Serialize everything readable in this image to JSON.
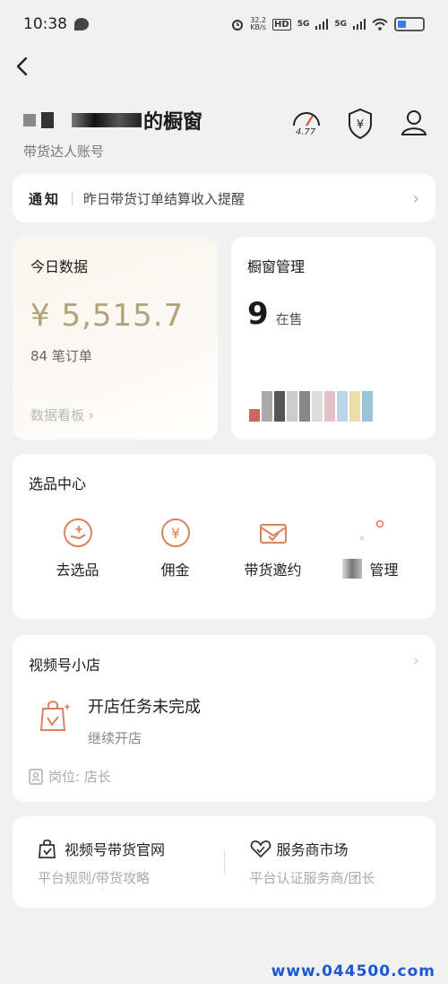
{
  "status_bar": {
    "time": "10:38",
    "net_speed_top": "32.2",
    "net_speed_unit": "KB/s",
    "hd": "HD",
    "sig1": "5G",
    "sig2": "5G"
  },
  "header": {
    "title_suffix": "的橱窗",
    "subtitle": "带货达人账号",
    "speed_score": "4.77"
  },
  "notice": {
    "tag": "通知",
    "text": "昨日带货订单结算收入提醒"
  },
  "today_data": {
    "title": "今日数据",
    "amount": "¥ 5,515.7",
    "orders": "84 笔订单",
    "link": "数据看板 ›"
  },
  "window_mgmt": {
    "title": "橱窗管理",
    "count": "9",
    "count_label": "在售"
  },
  "selection_center": {
    "title": "选品中心",
    "items": [
      {
        "label": "去选品",
        "icon": "selection-icon"
      },
      {
        "label": "佣金",
        "icon": "yen-coin-icon"
      },
      {
        "label": "带货邀约",
        "icon": "invitation-icon"
      },
      {
        "label": "管理",
        "icon": "management-icon"
      }
    ]
  },
  "video_shop": {
    "title": "视频号小店",
    "task_title": "开店任务未完成",
    "task_sub": "继续开店",
    "post": "岗位: 店长"
  },
  "bottom_links": [
    {
      "title": "视频号带货官网",
      "sub": "平台规则/带货攻略"
    },
    {
      "title": "服务商市场",
      "sub": "平台认证服务商/团长"
    }
  ],
  "watermark": "www.044500.com",
  "colors": {
    "accent": "#d9845f",
    "amount": "#b2a27a",
    "watermark": "#1a59d6"
  }
}
